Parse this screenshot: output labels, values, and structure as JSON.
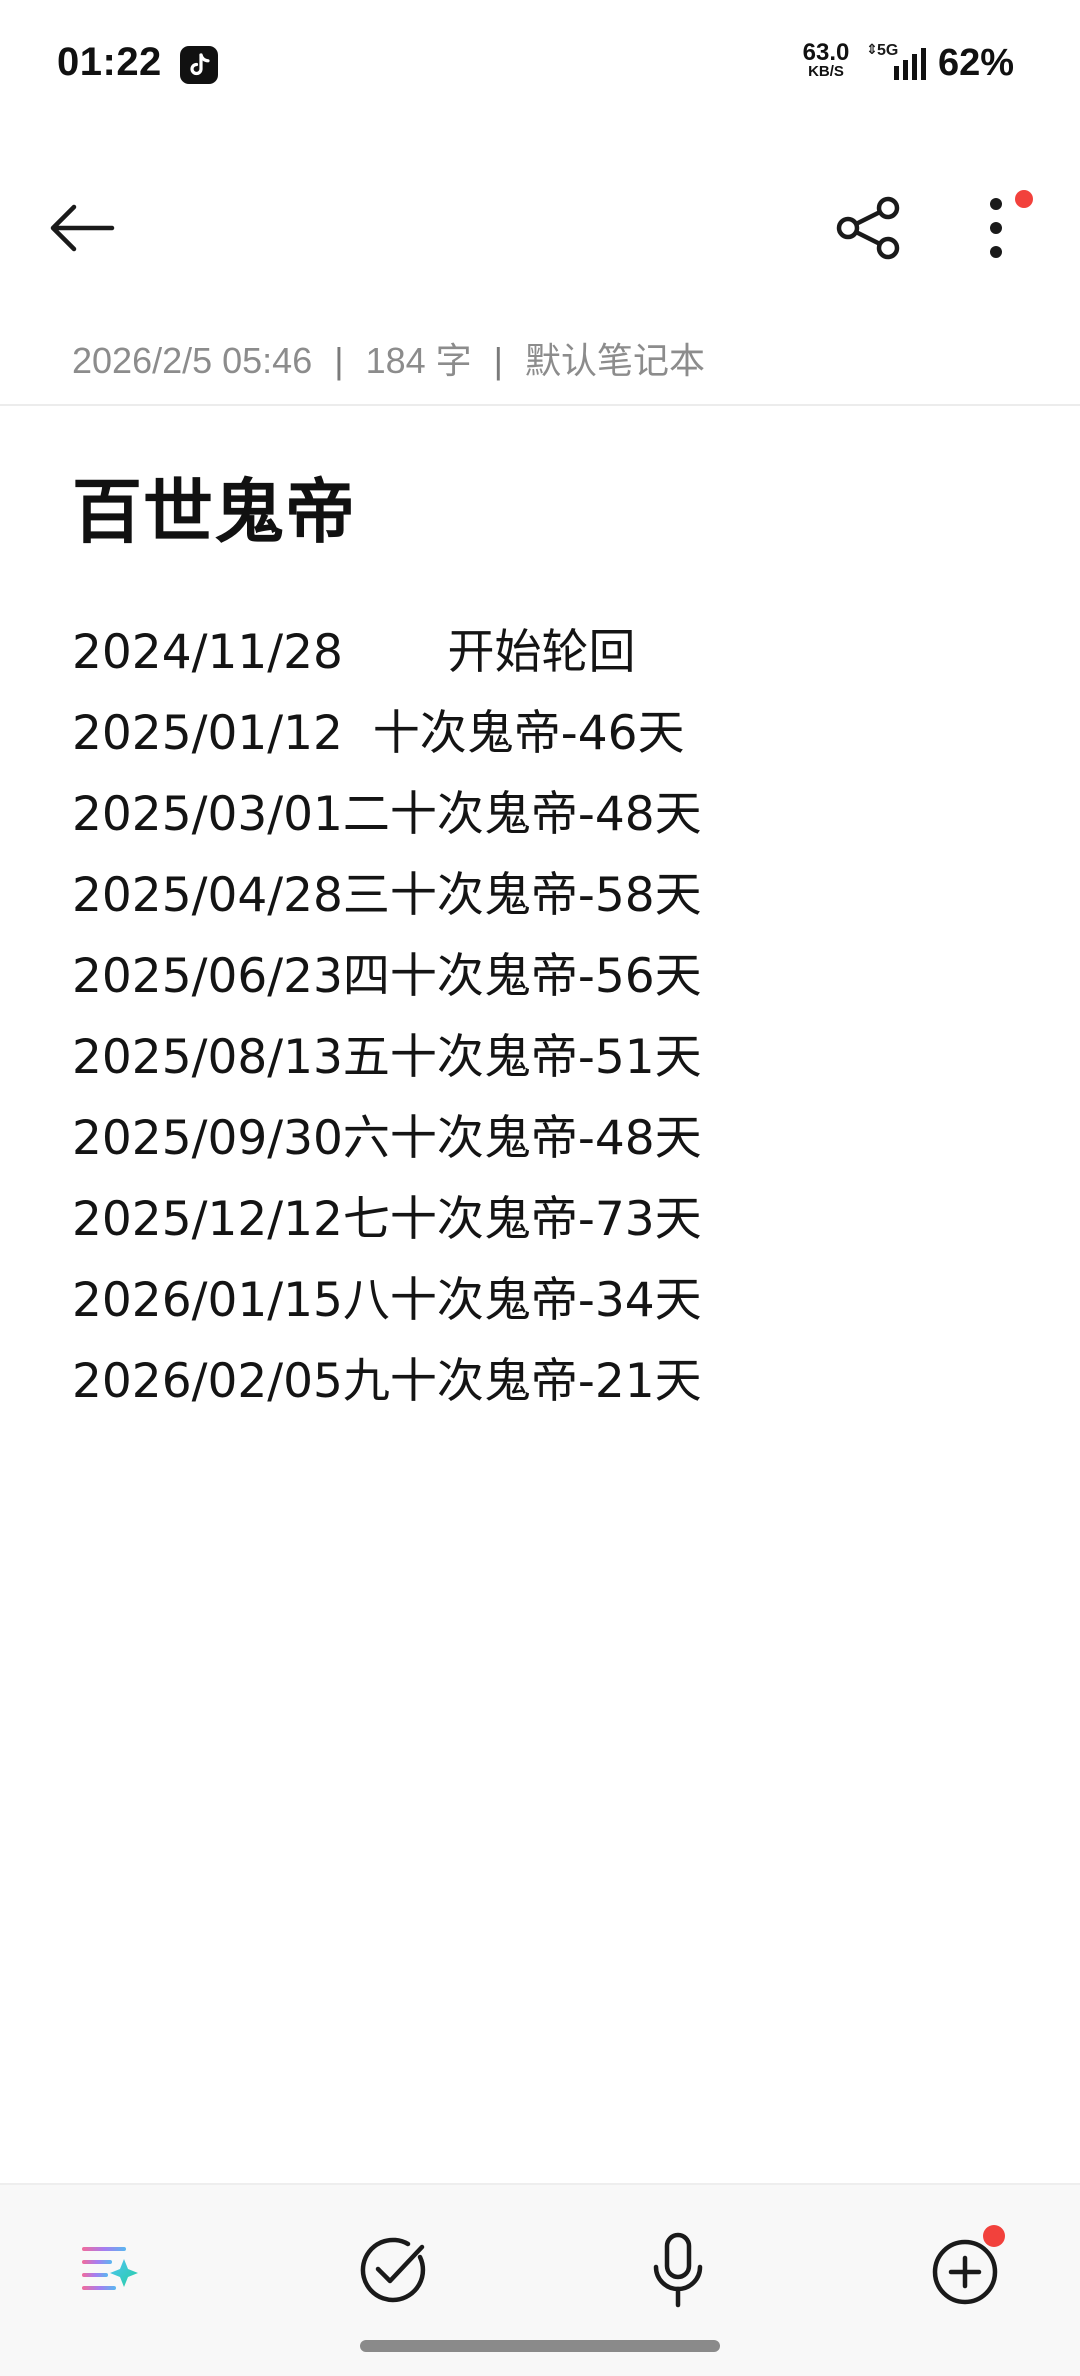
{
  "status_bar": {
    "time": "01:22",
    "app_icon": "tiktok-icon",
    "net_speed_value": "63.0",
    "net_speed_unit": "KB/S",
    "network_type": "5G",
    "battery": "62%"
  },
  "header": {
    "back_icon": "arrow-left-icon",
    "share_icon": "share-icon",
    "more_icon": "more-vertical-icon",
    "notification_dot_color": "#f2413c"
  },
  "meta": {
    "datetime": "2026/2/5 05:46",
    "separator": "|",
    "word_count": "184 字",
    "notebook": "默认笔记本"
  },
  "note": {
    "title": "百世鬼帝",
    "lines": [
      "2024/11/28       开始轮回",
      "2025/01/12  十次鬼帝-46天",
      "2025/03/01二十次鬼帝-48天",
      "2025/04/28三十次鬼帝-58天",
      "2025/06/23四十次鬼帝-56天",
      "2025/08/13五十次鬼帝-51天",
      "2025/09/30六十次鬼帝-48天",
      "2025/12/12七十次鬼帝-73天",
      "2026/01/15八十次鬼帝-34天",
      "2026/02/05九十次鬼帝-21天"
    ]
  },
  "toolbar": {
    "items": [
      {
        "icon": "ai-format-icon"
      },
      {
        "icon": "checklist-icon"
      },
      {
        "icon": "microphone-icon"
      },
      {
        "icon": "add-circle-icon"
      }
    ]
  }
}
